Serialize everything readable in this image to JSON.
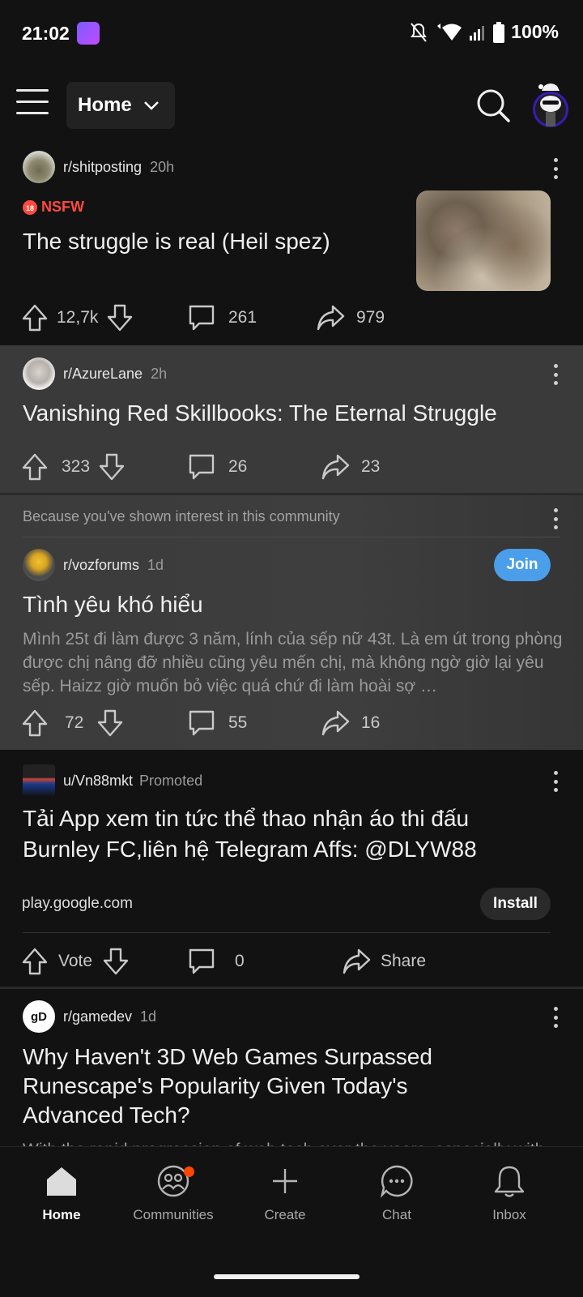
{
  "status_bar": {
    "time": "21:02",
    "battery": "100%"
  },
  "header": {
    "feed_label": "Home"
  },
  "posts": [
    {
      "subreddit": "r/shitposting",
      "age": "20h",
      "nsfw_label": "NSFW",
      "title": "The struggle is real (Heil spez)",
      "upvotes": "12,7k",
      "comments": "261",
      "shares": "979"
    },
    {
      "subreddit": "r/AzureLane",
      "age": "2h",
      "title": "Vanishing Red Skillbooks: The Eternal Struggle",
      "upvotes": "323",
      "comments": "26",
      "shares": "23"
    },
    {
      "reason": "Because you've shown interest in this community",
      "subreddit": "r/vozforums",
      "age": "1d",
      "join_label": "Join",
      "title": "Tình yêu khó hiểu",
      "body": "Mình 25t đi làm được 3 năm, lính của sếp nữ 43t. Là em út trong phòng được chị nâng đỡ nhiều cũng yêu mến chị, mà không ngờ giờ lại yêu sếp. Haizz giờ muốn bỏ việc quá chứ đi làm hoài sợ …",
      "upvotes": "72",
      "comments": "55",
      "shares": "16"
    },
    {
      "user": "u/Vn88mkt",
      "promoted_label": "Promoted",
      "title_line1": "Tải App xem tin tức thể thao nhận áo thi đấu",
      "title_line2": "Burnley FC,liên hệ Telegram Affs: @DLYW88",
      "domain": "play.google.com",
      "install_label": "Install",
      "vote_label": "Vote",
      "comments": "0",
      "share_label": "Share"
    },
    {
      "subreddit": "r/gamedev",
      "avatar_text": "gD",
      "age": "1d",
      "title_line1": "Why Haven't 3D Web Games Surpassed",
      "title_line2": "Runescape's Popularity Given Today's",
      "title_line3": "Advanced Tech?",
      "body": "With the rapid progression of web tech over the years, especially with the advent of WebAssembly and the growth of tools like"
    }
  ],
  "bottom_nav": [
    {
      "label": "Home",
      "icon": "home-icon"
    },
    {
      "label": "Communities",
      "icon": "communities-icon"
    },
    {
      "label": "Create",
      "icon": "plus-icon"
    },
    {
      "label": "Chat",
      "icon": "chat-icon"
    },
    {
      "label": "Inbox",
      "icon": "bell-icon"
    }
  ],
  "colors": {
    "accent_join": "#4a9eea",
    "nsfw": "#ff4a3d",
    "notification": "#ff4500",
    "background": "#121212"
  }
}
